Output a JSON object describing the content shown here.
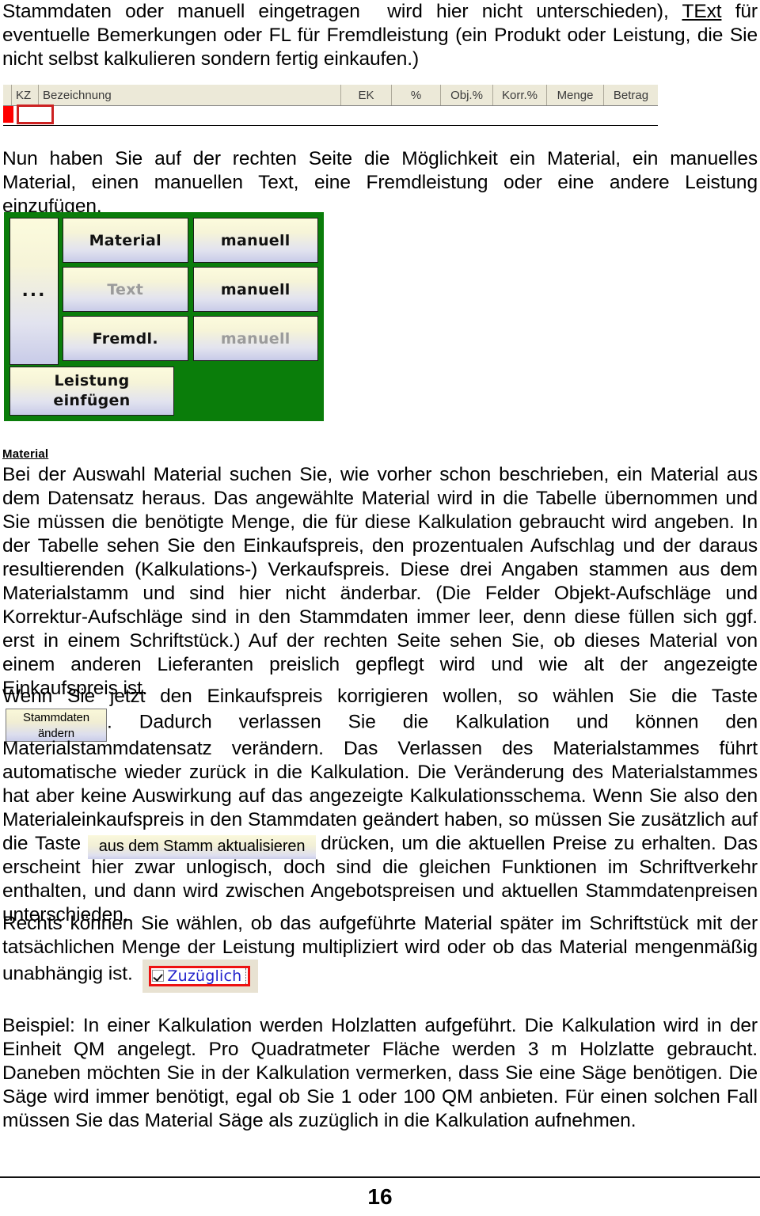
{
  "intro": {
    "paragraph": "Stammdaten oder manuell eingetragen  wird hier nicht unterschieden), TExt für eventuelle Bemerkungen oder FL für Fremdleistung (ein Produkt oder Leistung, die Sie nicht selbst kalkulieren sondern fertig einkaufen.)"
  },
  "grid": {
    "columns": [
      "KZ",
      "Bezeichnung",
      "EK",
      "%",
      "Obj.%",
      "Korr.%",
      "Menge",
      "Betrag"
    ],
    "row": {
      "marker_color": "#ff0000",
      "selection_border_color": "#cc2222",
      "cell_value": ""
    }
  },
  "mid": {
    "paragraph": "Nun haben Sie auf der rechten Seite die Möglichkeit ein Material, ein manuelles Material, einen manuellen Text, eine Fremdleistung oder eine andere Leistung einzufügen."
  },
  "panel": {
    "background_color": "#0a7d0a",
    "ellipsis_button": "...",
    "rows": [
      {
        "primary": "Material",
        "primary_enabled": true,
        "secondary": "manuell",
        "secondary_enabled": true
      },
      {
        "primary": "Text",
        "primary_enabled": false,
        "secondary": "manuell",
        "secondary_enabled": true
      },
      {
        "primary": "Fremdl.",
        "primary_enabled": true,
        "secondary": "manuell",
        "secondary_enabled": false
      }
    ],
    "insert_button": "Leistung\neinfügen"
  },
  "material_section": {
    "heading": "Material",
    "paragraph_1": "Bei der Auswahl Material suchen Sie, wie vorher schon beschrieben, ein Material aus dem Datensatz heraus. Das angewählte Material wird in die Tabelle übernommen und Sie müssen die benötigte Menge, die für diese Kalkulation gebraucht wird angeben. In der Tabelle sehen Sie den Einkaufspreis, den prozentualen Aufschlag und der daraus resultierenden (Kalkulations-) Verkaufspreis. Diese drei Angaben stammen aus dem Materialstamm und sind hier nicht änderbar. (Die Felder Objekt-Aufschläge und Korrektur-Aufschläge sind in den Stammdaten immer leer, denn diese füllen sich ggf. erst in einem Schriftstück.) Auf der rechten Seite sehen Sie, ob dieses Material von einem anderen Lieferanten preislich gepflegt wird und wie alt der angezeigte Einkaufspreis ist."
  },
  "wenn_section": {
    "text_before_button": "Wenn Sie jetzt den Einkaufspreis korrigieren wollen, so wählen Sie die Taste",
    "stammdaten_button": "Stammdaten ändern",
    "stammdaten_button_line1": "Stammdaten",
    "stammdaten_button_line2": "ändern",
    "text_after_button": ". Dadurch verlassen Sie die Kalkulation und können den Materialstammdatensatz verändern. Das Verlassen des Materialstammes führt automatische wieder zurück in die Kalkulation. Die Veränderung des Materialstammes hat aber keine Auswirkung auf das angezeigte Kalkulationsschema. Wenn Sie also den Materialeinkaufspreis in den Stammdaten geändert haben, so müssen Sie zusätzlich auf die Taste",
    "aktualisieren_button": "aus dem Stamm aktualisieren",
    "text_tail": "drücken, um die aktuellen Preise zu erhalten. Das erscheint hier zwar unlogisch, doch sind die gleichen Funktionen im Schriftverkehr enthalten, und dann wird zwischen Angebotspreisen und aktuellen Stammdatenpreisen unterschieden."
  },
  "rechts_section": {
    "text_before_widget": "Rechts können Sie wählen,  ob das aufgeführte Material später im Schriftstück mit der tatsächlichen Menge der Leistung multipliziert wird oder ob das Material mengenmäßig unabhängig ist.",
    "checkbox_label": "Zuzüglich",
    "checkbox_checked": true,
    "checkbox_highlight_color": "#ee1111",
    "checkbox_label_color": "#2222cc"
  },
  "beispiel_section": {
    "paragraph": "Beispiel: In einer Kalkulation werden Holzlatten aufgeführt. Die Kalkulation wird in der Einheit QM angelegt. Pro Quadratmeter Fläche werden 3 m Holzlatte gebraucht. Daneben möchten Sie in der Kalkulation vermerken, dass Sie eine Säge benötigen. Die Säge wird immer benötigt, egal ob Sie 1 oder 100 QM anbieten. Für einen solchen Fall müssen Sie das Material Säge als zuzüglich in die Kalkulation aufnehmen."
  },
  "footer": {
    "page_number": "16"
  }
}
